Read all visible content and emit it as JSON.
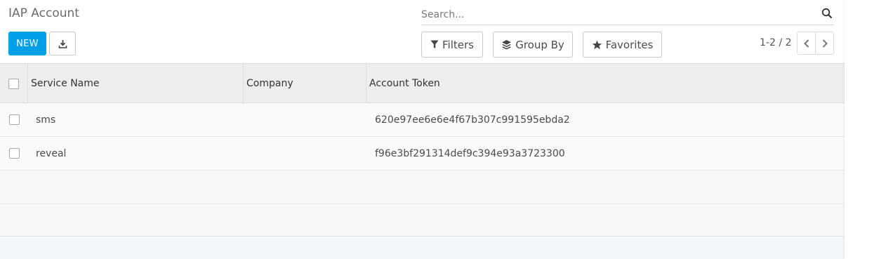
{
  "breadcrumb": {
    "title": "IAP Account"
  },
  "toolbar": {
    "new_label": "NEW",
    "download_icon": "download-icon"
  },
  "search": {
    "placeholder": "Search...",
    "value": "",
    "icon": "search-icon"
  },
  "facets": {
    "filters_label": "Filters",
    "groupby_label": "Group By",
    "favorites_label": "Favorites"
  },
  "pager": {
    "value": "1-2 / 2"
  },
  "table": {
    "columns": [
      "Service Name",
      "Company",
      "Account Token"
    ],
    "rows": [
      {
        "service_name": "sms",
        "company": "",
        "account_token": "620e97ee6e6e4f67b307c991595ebda2"
      },
      {
        "service_name": "reveal",
        "company": "",
        "account_token": "f96e3bf291314def9c394e93a3723300"
      }
    ]
  },
  "colors": {
    "accent": "#00a0e8",
    "header_bg": "#eeeeee",
    "footer_bg": "#f1f6fa"
  }
}
